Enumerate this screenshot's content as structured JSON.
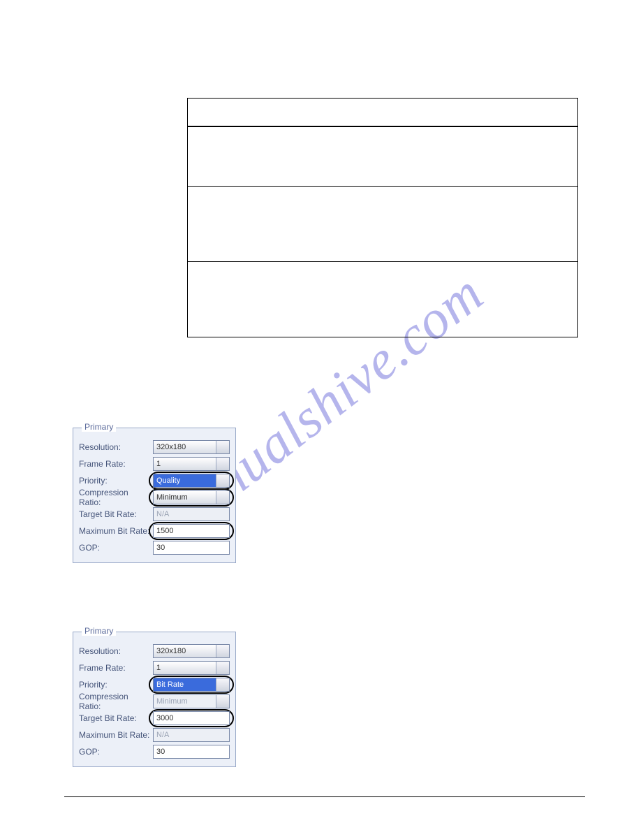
{
  "watermark": "manualshive.com",
  "panel1": {
    "legend": "Primary",
    "rows": [
      {
        "label": "Resolution:",
        "value": "320x180",
        "type": "dropdown"
      },
      {
        "label": "Frame Rate:",
        "value": "1",
        "type": "dropdown"
      },
      {
        "label": "Priority:",
        "value": "Quality",
        "type": "dropdown",
        "selected": true,
        "circled": true
      },
      {
        "label": "Compression Ratio:",
        "value": "Minimum",
        "type": "dropdown",
        "circled": true
      },
      {
        "label": "Target Bit Rate:",
        "value": "N/A",
        "type": "text",
        "disabled": true
      },
      {
        "label": "Maximum Bit Rate:",
        "value": "1500",
        "type": "text",
        "circled": true
      },
      {
        "label": "GOP:",
        "value": "30",
        "type": "text"
      }
    ]
  },
  "panel2": {
    "legend": "Primary",
    "rows": [
      {
        "label": "Resolution:",
        "value": "320x180",
        "type": "dropdown"
      },
      {
        "label": "Frame Rate:",
        "value": "1",
        "type": "dropdown"
      },
      {
        "label": "Priority:",
        "value": "Bit Rate",
        "type": "dropdown",
        "selected": true,
        "circled": true
      },
      {
        "label": "Compression Ratio:",
        "value": "Minimum",
        "type": "dropdown",
        "disabled": true
      },
      {
        "label": "Target Bit Rate:",
        "value": "3000",
        "type": "text",
        "circled": true
      },
      {
        "label": "Maximum Bit Rate:",
        "value": "N/A",
        "type": "text",
        "disabled": true
      },
      {
        "label": "GOP:",
        "value": "30",
        "type": "text"
      }
    ]
  }
}
